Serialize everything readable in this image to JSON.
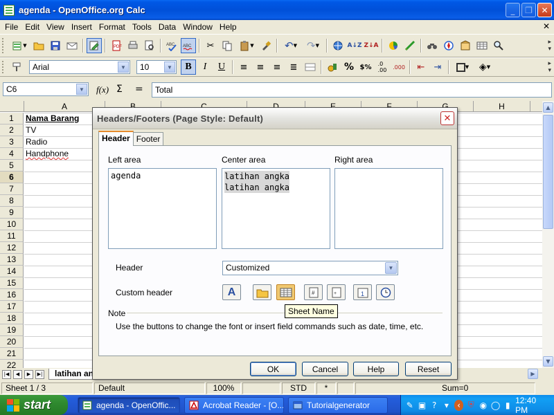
{
  "window": {
    "title": "agenda - OpenOffice.org Calc"
  },
  "menu": [
    "File",
    "Edit",
    "View",
    "Insert",
    "Format",
    "Tools",
    "Data",
    "Window",
    "Help"
  ],
  "format_bar": {
    "font_name": "Arial",
    "font_size": "10"
  },
  "formula_bar": {
    "cell_ref": "C6",
    "content": "Total"
  },
  "sheet": {
    "columns": [
      "A",
      "B",
      "C",
      "D",
      "E",
      "F",
      "G",
      "H"
    ],
    "rows": [
      "1",
      "2",
      "3",
      "4",
      "5",
      "6",
      "7",
      "8",
      "9",
      "10",
      "11",
      "12",
      "13",
      "14",
      "15",
      "16",
      "17",
      "18",
      "19",
      "20",
      "21",
      "22"
    ],
    "cells": {
      "A1": "Nama  Barang",
      "A2": "TV",
      "A3": "Radio",
      "A4": "Handphone"
    },
    "active_row": "6",
    "tab_name": "latihan an"
  },
  "status": {
    "sheet": "Sheet 1 / 3",
    "page_style": "Default",
    "zoom": "100%",
    "mode": "STD",
    "modified": "*",
    "sum": "Sum=0"
  },
  "dialog": {
    "title": "Headers/Footers (Page Style: Default)",
    "tabs": [
      "Header",
      "Footer"
    ],
    "left_area_label": "Left area",
    "center_area_label": "Center area",
    "right_area_label": "Right area",
    "left_area_text": "agenda",
    "center_area_lines": [
      "latihan angka",
      "latihan angka"
    ],
    "right_area_text": "",
    "header_label": "Header",
    "header_value": "Customized",
    "custom_header_label": "Custom header",
    "note_label": "Note",
    "note_text": "Use the buttons to change the font or insert field commands such as date, time, etc.",
    "tooltip": "Sheet Name",
    "buttons": {
      "ok": "OK",
      "cancel": "Cancel",
      "help": "Help",
      "reset": "Reset"
    }
  },
  "taskbar": {
    "start": "start",
    "tasks": [
      "agenda - OpenOffic...",
      "Acrobat Reader - [O...",
      "Tutorialgenerator"
    ],
    "clock": "12:40 PM"
  },
  "colors": {
    "titlebar": "#0054e3",
    "dialog_bg": "#ece9d8",
    "selection_gray": "#d8d8d8",
    "tooltip_bg": "#ffffe1"
  }
}
